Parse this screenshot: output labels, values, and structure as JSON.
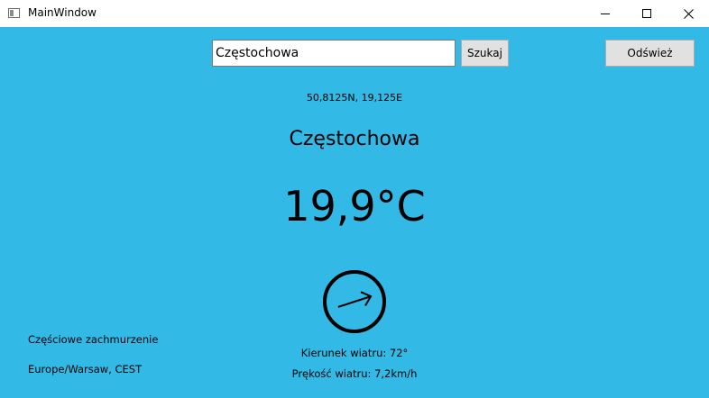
{
  "window": {
    "title": "MainWindow",
    "controls": {
      "minimize": "minimize-icon",
      "maximize": "maximize-icon",
      "close": "close-icon"
    }
  },
  "search": {
    "value": "Częstochowa",
    "button_label": "Szukaj"
  },
  "refresh_label": "Odśwież",
  "weather": {
    "coords": "50,8125N, 19,125E",
    "city": "Częstochowa",
    "temperature": "19,9°C",
    "wind_direction_deg": 72,
    "wind_direction_text": "Kierunek wiatru: 72°",
    "wind_speed_text": "Prękość wiatru: 7,2km/h",
    "description": "Częściowe zachmurzenie",
    "timezone": "Europe/Warsaw, CEST"
  },
  "colors": {
    "background": "#33b9e6",
    "titlebar": "#ffffff",
    "button": "#e1e1e1"
  }
}
